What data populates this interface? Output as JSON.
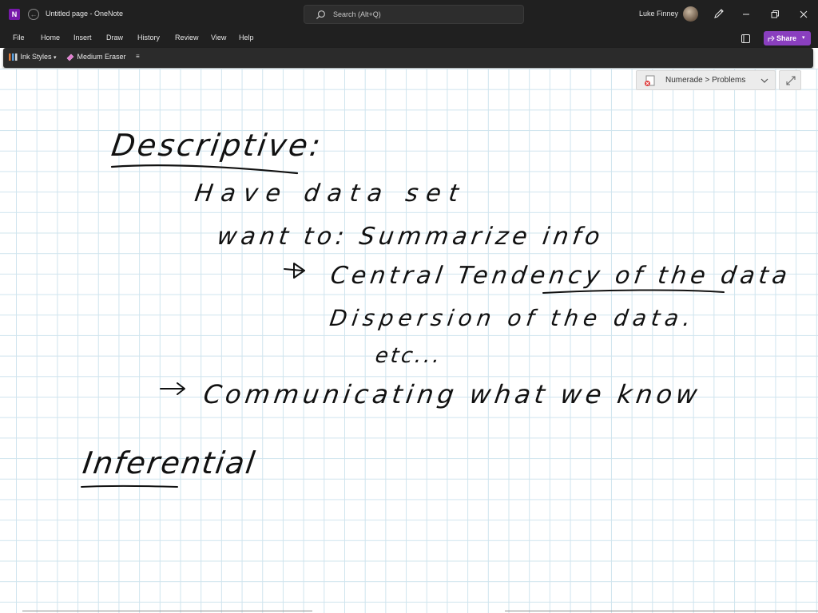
{
  "window": {
    "title": "Untitled page - OneNote",
    "user": "Luke Finney"
  },
  "search": {
    "placeholder": "Search (Alt+Q)"
  },
  "menu": {
    "tabs": [
      "File",
      "Home",
      "Insert",
      "Draw",
      "History",
      "Review",
      "View",
      "Help"
    ],
    "share_label": "Share"
  },
  "toolbar": {
    "ink_styles": "Ink Styles",
    "eraser": "Medium Eraser"
  },
  "numerade": {
    "label": "Numerade > Problems"
  },
  "note": {
    "lines": [
      "Descriptive:",
      "Have data set",
      "want to: Summarize info",
      "Central Tendency of the data",
      "Dispersion of the data.",
      "etc...",
      "Communicating what we know",
      "Inferential"
    ]
  },
  "colors": {
    "titlebar": "#202020",
    "toolbar": "#2b2b2b",
    "share": "#8a3fbf",
    "grid": "#cfe4ee",
    "ink": "#111111"
  },
  "icons": {
    "app": "onenote-icon",
    "search": "search-icon",
    "pen": "pen-icon",
    "share": "share-icon",
    "notebook": "notebook-icon",
    "expand": "expand-icon"
  }
}
